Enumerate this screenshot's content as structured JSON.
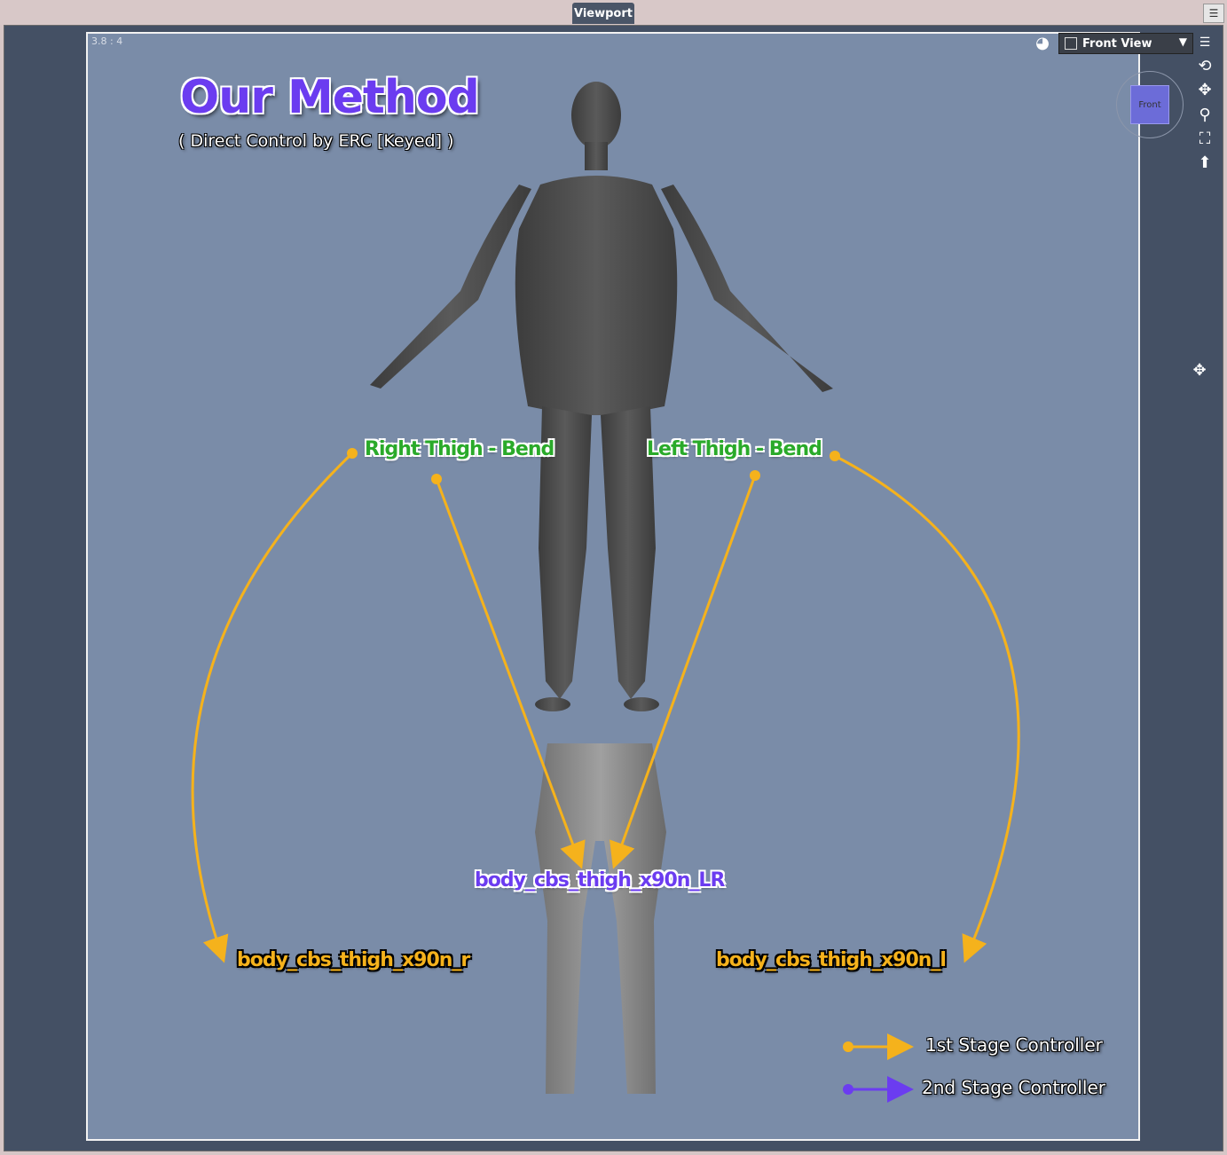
{
  "window": {
    "tab_title": "Viewport"
  },
  "viewport": {
    "aspect_ratio": "3.8 : 4",
    "view_name": "Front View",
    "cube_label": "Front",
    "background": "#7a8ca8"
  },
  "diagram": {
    "title": "Our Method",
    "subtitle": "( Direct Control by ERC [Keyed] )",
    "nodes": {
      "right_thigh": "Right Thigh - Bend",
      "left_thigh": "Left Thigh - Bend",
      "center_morph": "body_cbs_thigh_x90n_LR",
      "right_morph": "body_cbs_thigh_x90n_r",
      "left_morph": "body_cbs_thigh_x90n_l"
    },
    "legend": {
      "first": "1st Stage Controller",
      "second": "2nd Stage Controller"
    },
    "colors": {
      "first_stage": "#f5b21c",
      "second_stage": "#6b3cf0",
      "controller_label": "#2aaa2a"
    }
  },
  "toolbar": {
    "icons": [
      "orbit-icon",
      "pan-icon",
      "zoom-icon",
      "frame-icon",
      "reset-icon"
    ]
  }
}
